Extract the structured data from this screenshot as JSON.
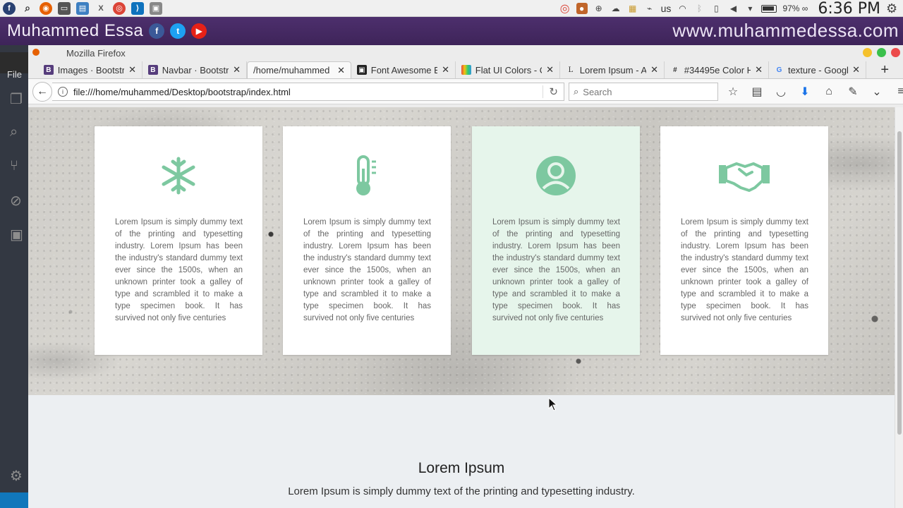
{
  "system_panel": {
    "keyboard_layout": "us",
    "battery": "97% ∞",
    "clock": "6:36 PM"
  },
  "banner": {
    "name": "Muhammed Essa",
    "url": "www.muhammedessa.com",
    "social": [
      "f",
      "t",
      "▶"
    ]
  },
  "editor": {
    "file_label": "File"
  },
  "browser": {
    "title": "Mozilla Firefox",
    "tabs": [
      {
        "label": "Images · Bootstr",
        "fav": "B",
        "color": "#563d7c"
      },
      {
        "label": "Navbar · Bootstr",
        "fav": "B",
        "color": "#563d7c"
      },
      {
        "label": "/home/muhammed",
        "fav": "",
        "color": ""
      },
      {
        "label": "Font Awesome E",
        "fav": "▣",
        "color": "#222222"
      },
      {
        "label": "Flat UI Colors - C",
        "fav": "■",
        "color": "#e67e22"
      },
      {
        "label": "Lorem Ipsum - A",
        "fav": "L",
        "color": ""
      },
      {
        "label": "#34495e Color H",
        "fav": "#",
        "color": ""
      },
      {
        "label": "texture - Google",
        "fav": "G",
        "color": ""
      }
    ],
    "url": "file:///home/muhammed/Desktop/bootstrap/index.html",
    "search_placeholder": "Search"
  },
  "page": {
    "cards": [
      {
        "icon": "snowflake-icon",
        "text": "Lorem Ipsum is simply dummy text of the printing and typesetting industry. Lorem Ipsum has been the industry's standard dummy text ever since the 1500s, when an unknown printer took a galley of type and scrambled it to make a type specimen book. It has survived not only five centuries"
      },
      {
        "icon": "thermometer-icon",
        "text": "Lorem Ipsum is simply dummy text of the printing and typesetting industry. Lorem Ipsum has been the industry's standard dummy text ever since the 1500s, when an unknown printer took a galley of type and scrambled it to make a type specimen book. It has survived not only five centuries"
      },
      {
        "icon": "user-circle-icon",
        "text": "Lorem Ipsum is simply dummy text of the printing and typesetting industry. Lorem Ipsum has been the industry's standard dummy text ever since the 1500s, when an unknown printer took a galley of type and scrambled it to make a type specimen book. It has survived not only five centuries"
      },
      {
        "icon": "handshake-icon",
        "text": "Lorem Ipsum is simply dummy text of the printing and typesetting industry. Lorem Ipsum has been the industry's standard dummy text ever since the 1500s, when an unknown printer took a galley of type and scrambled it to make a type specimen book. It has survived not only five centuries"
      }
    ],
    "section_title": "Lorem Ipsum",
    "section_subtitle": "Lorem Ipsum is simply dummy text of the printing and typesetting industry."
  },
  "colors": {
    "accent_green": "#7dc8a0",
    "banner_purple": "#4d2f6d",
    "card_highlight": "#e6f5eb"
  }
}
